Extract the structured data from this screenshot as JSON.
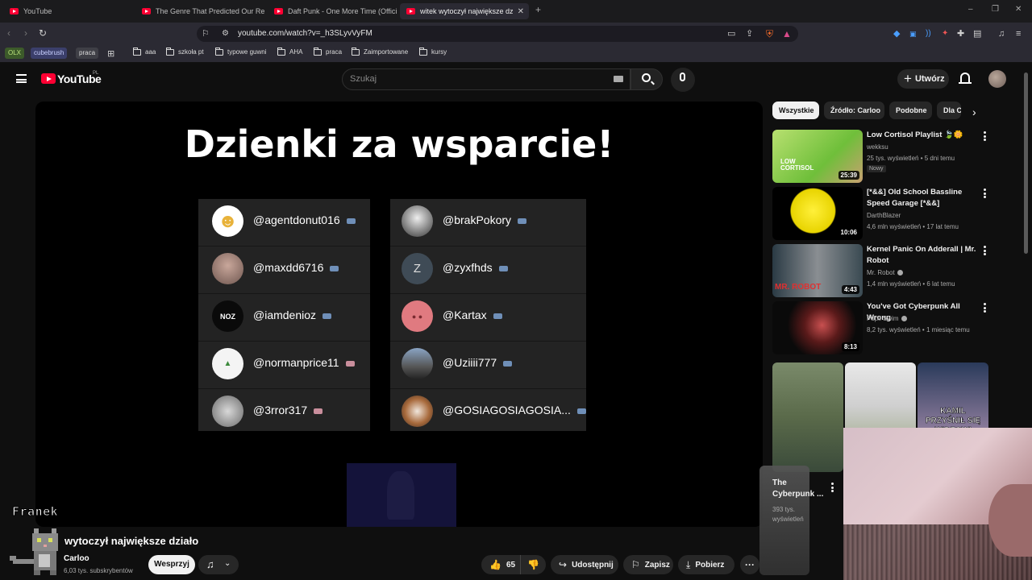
{
  "browser": {
    "tabs": [
      {
        "title": "YouTube",
        "active": false
      },
      {
        "title": "The Genre That Predicted Our Reality",
        "active": false
      },
      {
        "title": "Daft Punk - One More Time (Official",
        "active": false
      },
      {
        "title": "witek wytoczył największe dział",
        "active": true
      }
    ],
    "url": "youtube.com/watch?v=_h3SLyvVyFM",
    "bookmarks": {
      "chips": [
        "OLX",
        "cubebrush",
        "praca"
      ],
      "folders": [
        "aaa",
        "szkoła pt",
        "typowe guwni",
        "AHA",
        "praca",
        "Zaimportowane",
        "kursy"
      ]
    }
  },
  "youtube": {
    "logo_text": "YouTube",
    "country": "PL",
    "search_placeholder": "Szukaj",
    "create_label": "Utwórz"
  },
  "video": {
    "overlay_title": "Dzienki za wsparcie!",
    "supporters_left": [
      "@agentdonut016",
      "@maxdd6716",
      "@iamdenioz",
      "@normanprice11",
      "@3rror317"
    ],
    "supporters_right": [
      "@brakPokory",
      "@zyxfhds",
      "@Kartax",
      "@Uziiii777",
      "@GOSIAGOSIAGOSIA..."
    ],
    "zyx_initial": "Z",
    "watermark": "Franek",
    "title": "wytoczył największe działo",
    "channel": "Carloo",
    "subscribers": "6,03 tys. subskrybentów",
    "support_label": "Wesprzyj",
    "likes": "65",
    "share_label": "Udostępnij",
    "save_label": "Zapisz",
    "download_label": "Pobierz"
  },
  "sidebar": {
    "chips": [
      "Wszystkie",
      "Źródło: Carloo",
      "Podobne",
      "Dla C"
    ],
    "recommendations": [
      {
        "title": "Low Cortisol Playlist 🍃🌼",
        "channel": "wekksu",
        "meta": "25 tys. wyświetleń • 5 dni temu",
        "badge": "Nowy",
        "duration": "25:39",
        "thumb_text": "LOW CORTISOL"
      },
      {
        "title": "[*&&] Old School Bassline Speed Garage [*&&]",
        "channel": "DarthBlazer",
        "meta": "4,6 mln wyświetleń • 17 lat temu",
        "duration": "10:06"
      },
      {
        "title": "Kernel Panic On Adderall | Mr. Robot",
        "channel": "Mr. Robot",
        "meta": "1,4 mln wyświetleń • 6 lat temu",
        "duration": "4:43",
        "thumb_text": "MR. ROBOT"
      },
      {
        "title": "You've Got Cyberpunk All Wrong",
        "channel": "Pupil Swim",
        "meta": "8,2 tys. wyświetleń • 1 miesiąc temu",
        "duration": "8:13"
      }
    ],
    "shorts": [
      {
        "title": "",
        "meta": ""
      },
      {
        "title": "",
        "meta": ""
      },
      {
        "title": "KAMIL PRZYŚNIŁ SIĘ WIDZOWI",
        "meta": ""
      }
    ],
    "extra": {
      "title": "The Cyberpunk ...",
      "meta": "393 tys. wyświetleń"
    }
  }
}
